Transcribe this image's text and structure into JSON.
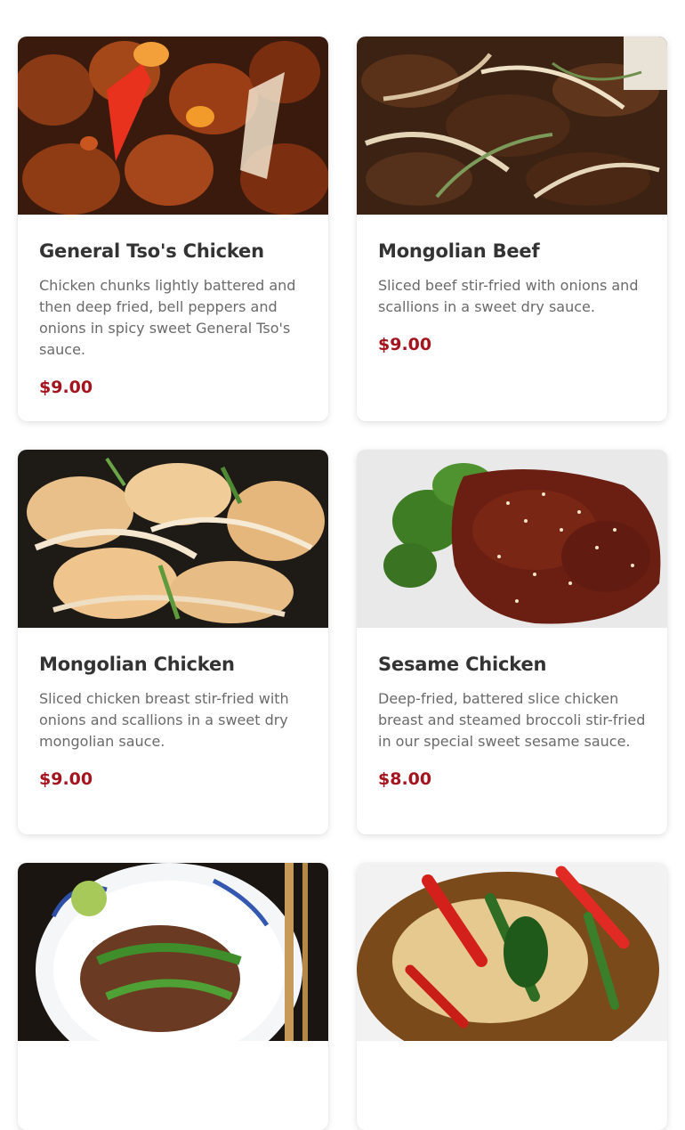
{
  "menu": {
    "items": [
      {
        "name": "General Tso's Chicken",
        "description": "Chicken chunks lightly battered and then deep fried, bell peppers and onions in spicy sweet General Tso's sauce.",
        "price": "$9.00",
        "photo_alt": "general-tso-chicken-photo"
      },
      {
        "name": "Mongolian Beef",
        "description": "Sliced beef stir-fried with onions and scallions in a sweet dry sauce.",
        "price": "$9.00",
        "photo_alt": "mongolian-beef-photo"
      },
      {
        "name": "Mongolian Chicken",
        "description": "Sliced chicken breast stir-fried with onions and scallions in a sweet dry mongolian sauce.",
        "price": "$9.00",
        "photo_alt": "mongolian-chicken-photo"
      },
      {
        "name": "Sesame Chicken",
        "description": "Deep-fried, battered slice chicken breast and steamed broccoli stir-fried in our special sweet sesame sauce.",
        "price": "$8.00",
        "photo_alt": "sesame-chicken-photo"
      }
    ]
  },
  "colors": {
    "price": "#a3141f",
    "title": "#333333",
    "description": "#6a6a6a"
  }
}
